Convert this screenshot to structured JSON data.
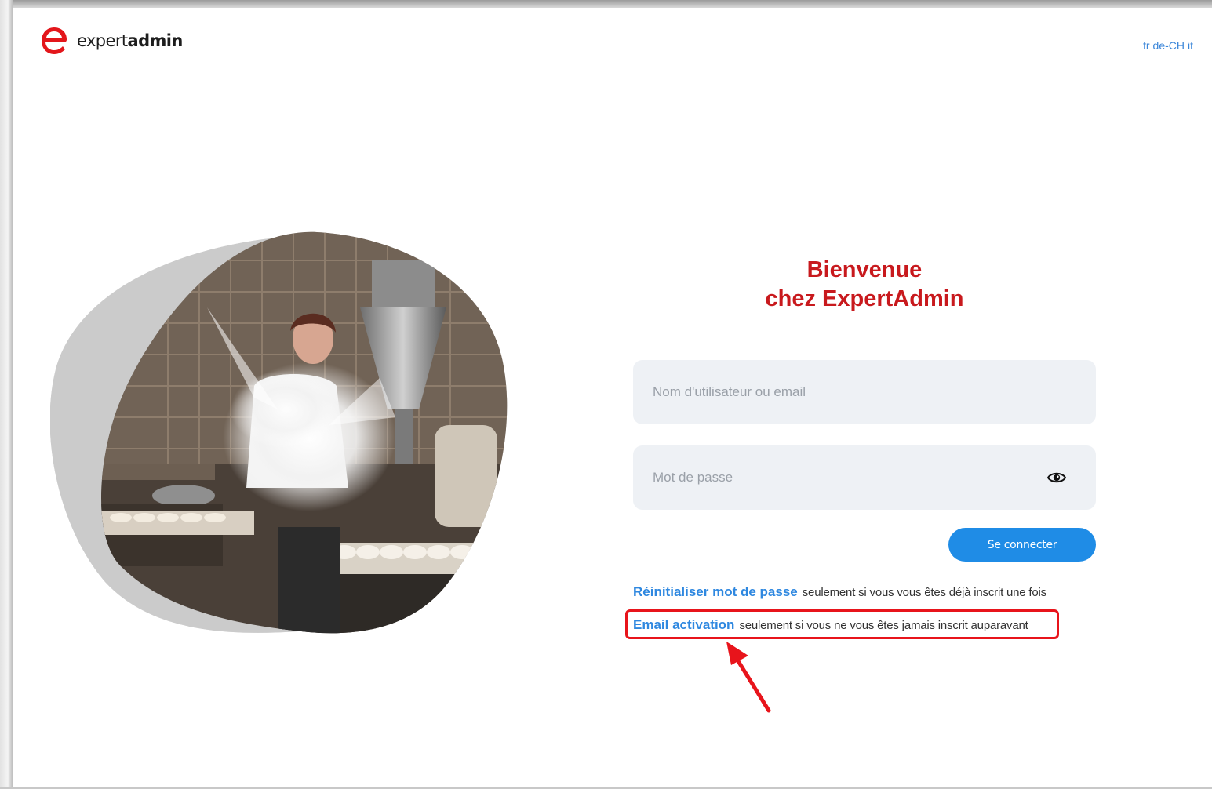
{
  "brand": {
    "logo_text_light": "expert",
    "logo_text_bold": "admin",
    "color": "#e3161b"
  },
  "languages": [
    "fr",
    "de-CH",
    "it"
  ],
  "welcome": {
    "line1": "Bienvenue",
    "line2": "chez ExpertAdmin",
    "color": "#c8191d"
  },
  "login": {
    "username_placeholder": "Nom d'utilisateur ou email",
    "password_placeholder": "Mot de passe",
    "submit_label": "Se connecter",
    "accent": "#1f8ce6"
  },
  "links": {
    "reset": {
      "label": "Réinitialiser mot de passe",
      "note": "seulement si vous vous êtes déjà inscrit une fois"
    },
    "activation": {
      "label": "Email activation",
      "note": "seulement si vous ne vous êtes jamais inscrit auparavant"
    }
  },
  "icons": {
    "eye": "eye-icon"
  },
  "annotation": {
    "highlight_color": "#e8141b"
  }
}
